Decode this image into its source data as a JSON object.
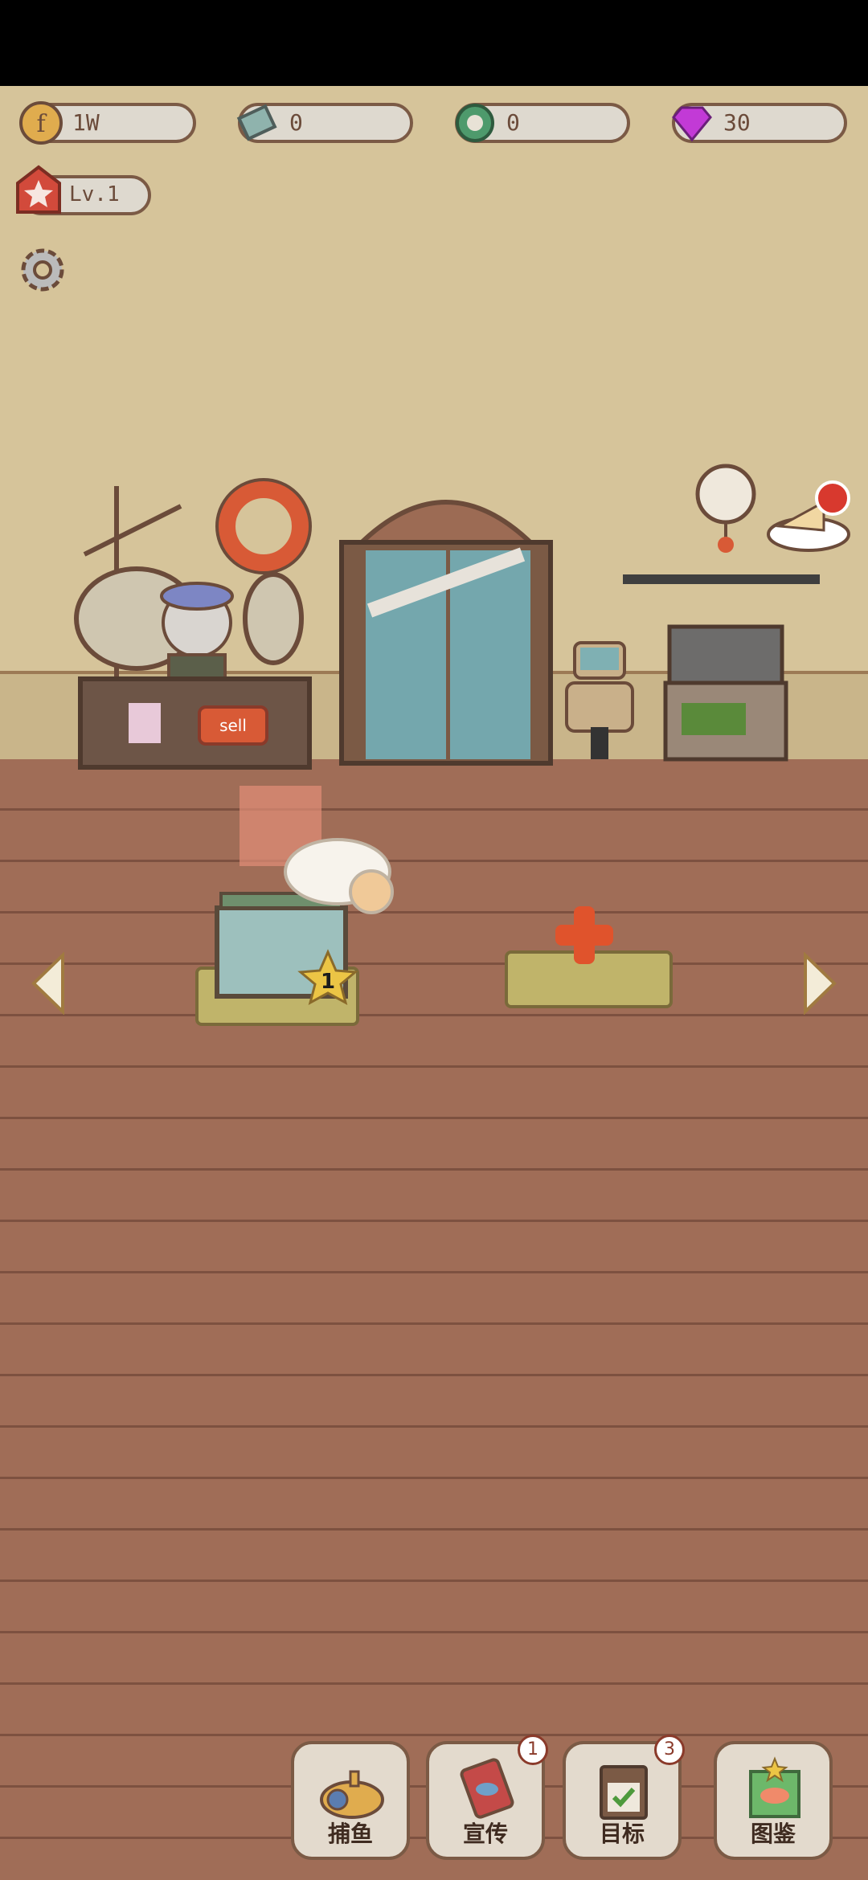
{
  "currencies": {
    "coins": "1W",
    "cash": "0",
    "pearls": "0",
    "gems": "30"
  },
  "level": "Lv.1",
  "shop": {
    "sell_sign": "sell",
    "tank_level": "1"
  },
  "bottom_nav": [
    {
      "label": "捕鱼",
      "badge": ""
    },
    {
      "label": "宣传",
      "badge": "1"
    },
    {
      "label": "目标",
      "badge": "3"
    },
    {
      "label": "图鉴",
      "badge": ""
    }
  ],
  "colors": {
    "wall": "#d6c49a",
    "floor": "#a06d57",
    "outline": "#7b5a45",
    "gem": "#c23ad6",
    "plus": "#e0532c"
  },
  "icons": [
    "coin-icon",
    "cash-icon",
    "pearl-icon",
    "gem-icon",
    "star-icon",
    "gear-icon",
    "left-arrow-icon",
    "right-arrow-icon",
    "submarine-icon",
    "promo-icon",
    "goal-icon",
    "catalog-icon"
  ]
}
